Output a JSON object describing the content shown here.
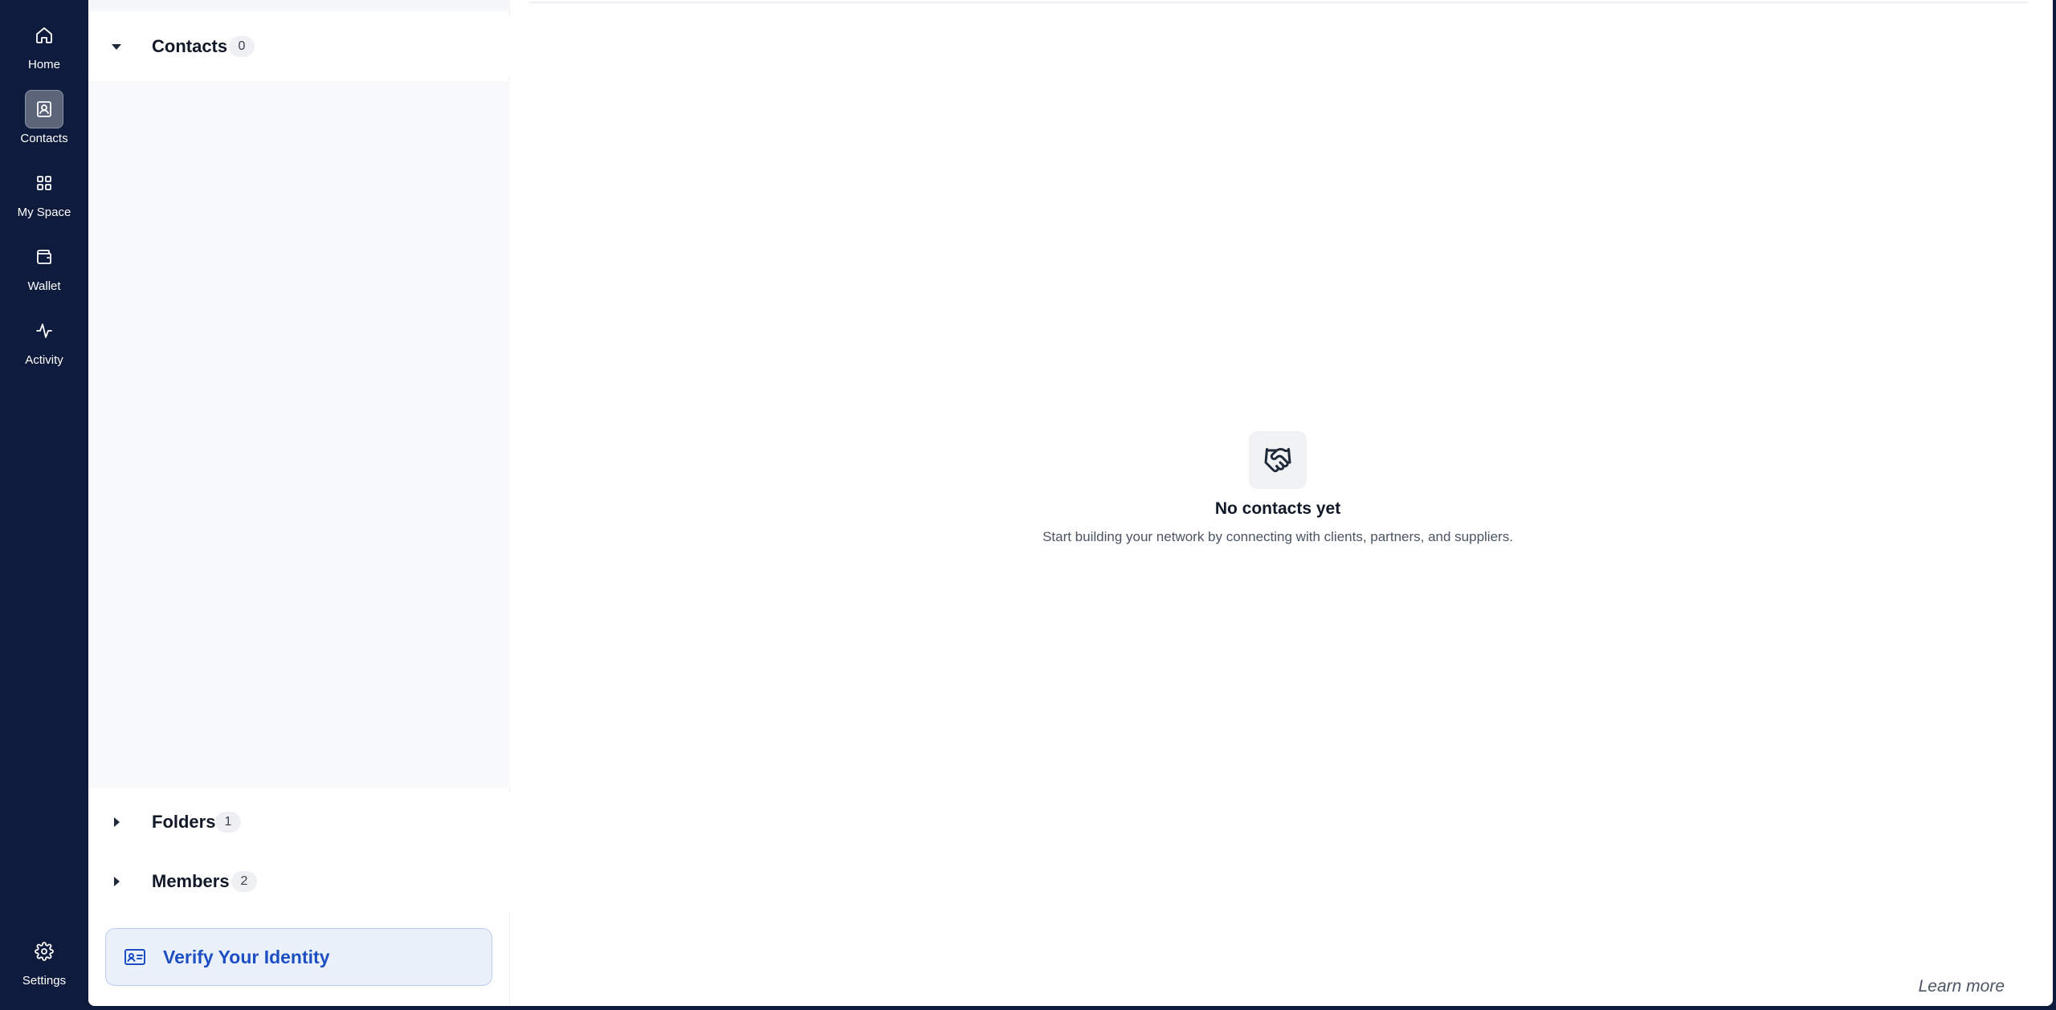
{
  "nav": {
    "items": [
      {
        "label": "Home",
        "icon": "home-icon"
      },
      {
        "label": "Contacts",
        "icon": "contacts-icon",
        "active": true
      },
      {
        "label": "My Space",
        "icon": "grid-icon"
      },
      {
        "label": "Wallet",
        "icon": "wallet-icon"
      },
      {
        "label": "Activity",
        "icon": "activity-icon"
      }
    ],
    "settings_label": "Settings"
  },
  "sidebar": {
    "contacts": {
      "title": "Contacts",
      "count": "0",
      "expanded": true
    },
    "folders": {
      "title": "Folders",
      "count": "1",
      "expanded": false
    },
    "members": {
      "title": "Members",
      "count": "2",
      "expanded": false
    },
    "verify_label": "Verify Your Identity"
  },
  "main": {
    "empty_icon": "handshake-icon",
    "empty_title": "No contacts yet",
    "empty_subtitle": "Start building your network by connecting with clients, partners, and suppliers.",
    "learn_more": "Learn more"
  },
  "colors": {
    "rail_bg": "#0f1b3d",
    "accent": "#1e4fc2",
    "verify_bg": "#eaf1fb"
  }
}
